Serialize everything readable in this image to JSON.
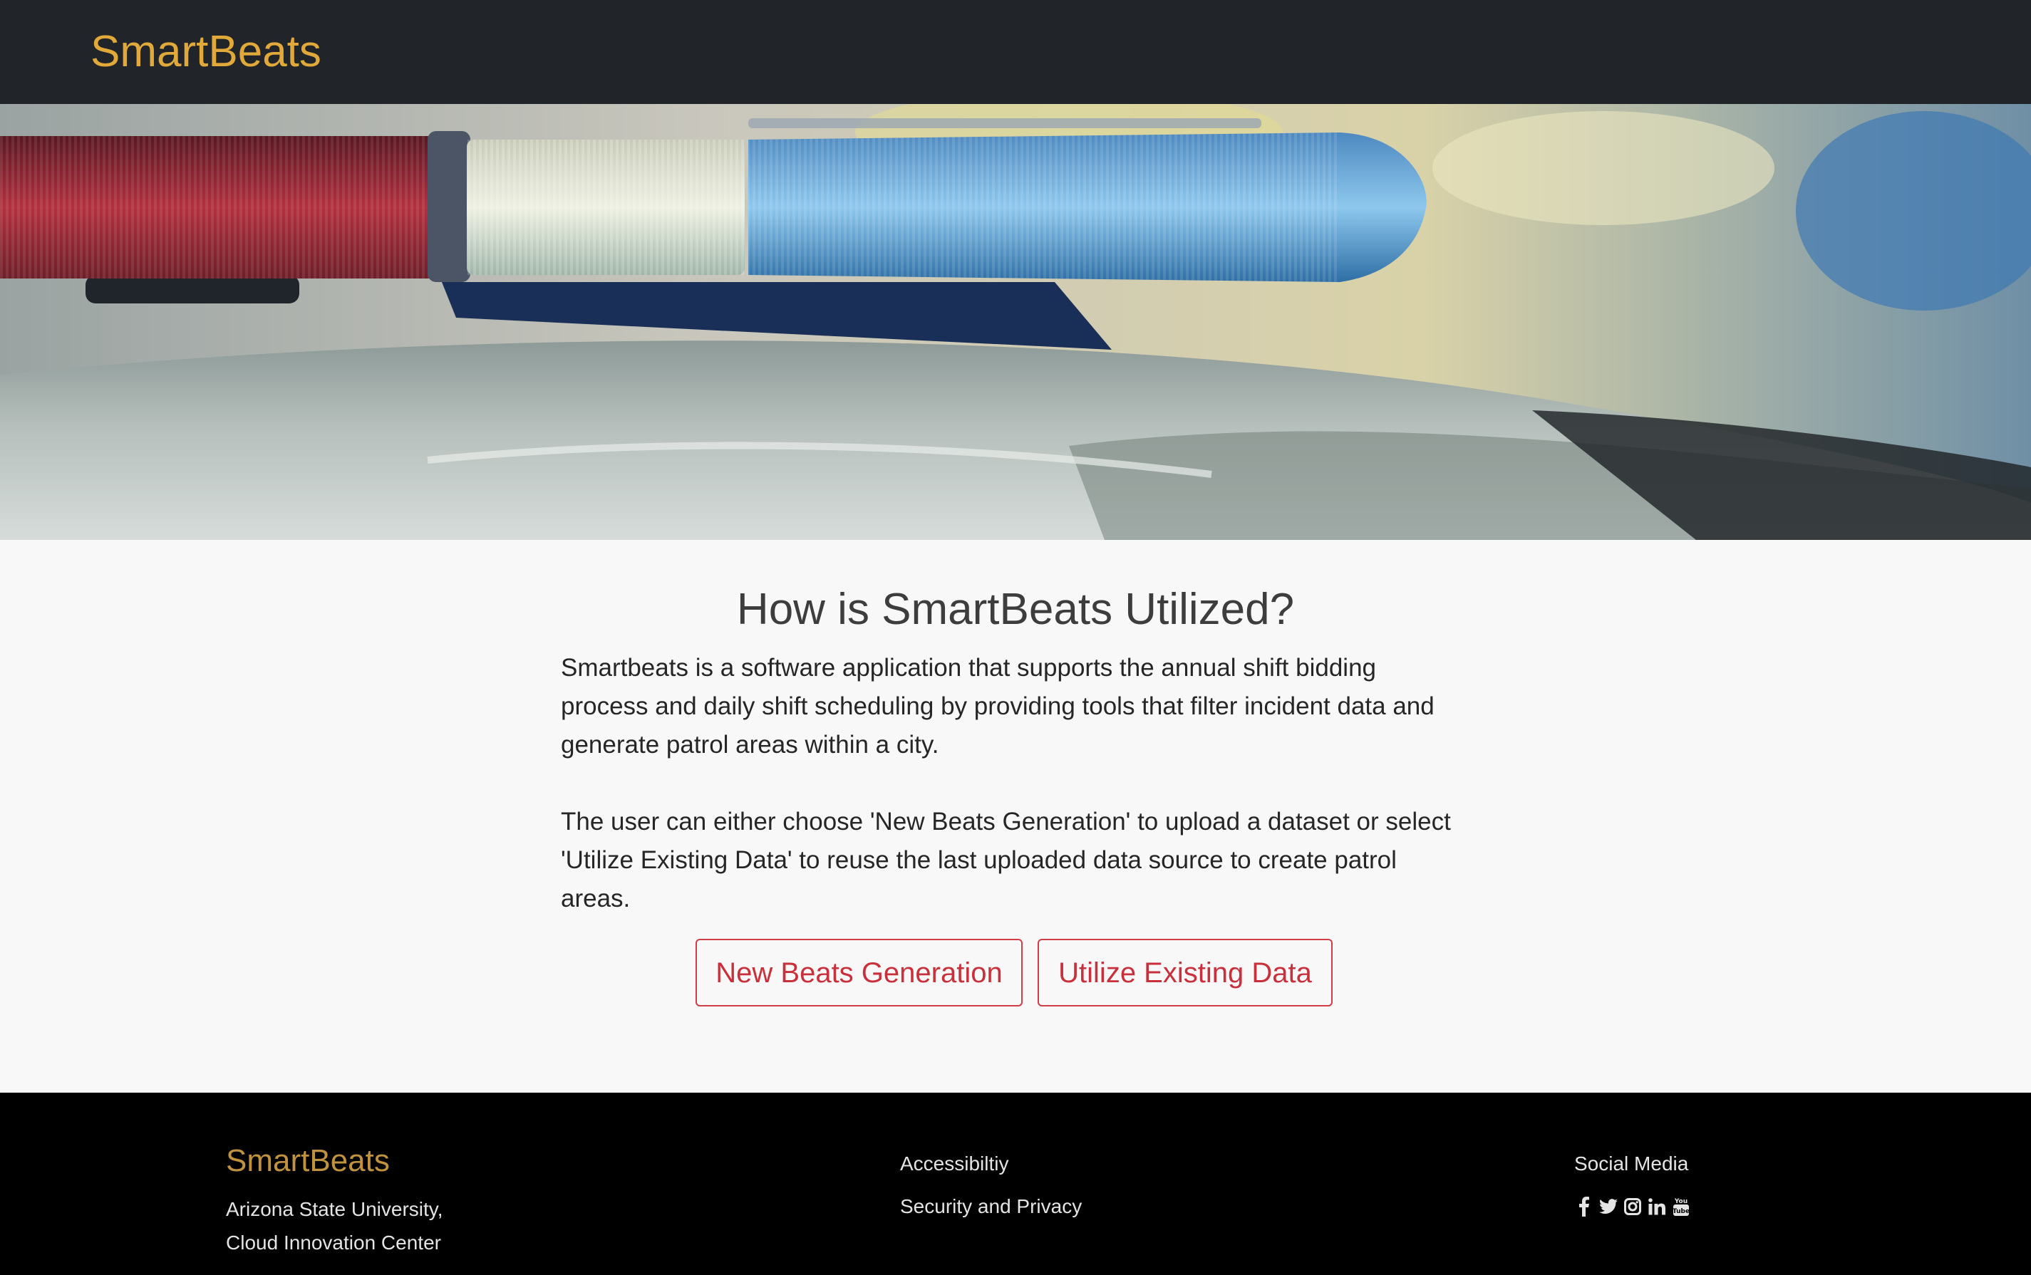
{
  "navbar": {
    "brand": "SmartBeats"
  },
  "hero": {
    "image": "police-car-lightbar-photo"
  },
  "main": {
    "title": "How is SmartBeats Utilized?",
    "paragraph1": "Smartbeats is a software application that supports the annual shift bidding process and daily shift scheduling by providing tools that filter incident data and generate patrol areas within a city.",
    "paragraph2": "The user can either choose 'New Beats Generation' to upload a dataset or select 'Utilize Existing Data' to reuse the last uploaded data source to create patrol areas.",
    "buttons": {
      "new_beats": "New Beats Generation",
      "existing_data": "Utilize Existing Data"
    }
  },
  "footer": {
    "brand": "SmartBeats",
    "address_line1": "Arizona State University,",
    "address_line2": "Cloud Innovation Center",
    "links": [
      "Accessibiltiy",
      "Security and Privacy"
    ],
    "social_heading": "Social Media",
    "social_icons": [
      "facebook-icon",
      "twitter-icon",
      "instagram-icon",
      "linkedin-icon",
      "youtube-icon"
    ]
  },
  "colors": {
    "navbar_bg": "#212529",
    "brand": "#e0a93a",
    "button_accent": "#c8303b",
    "footer_bg": "#000000",
    "footer_brand": "#c0913f"
  }
}
